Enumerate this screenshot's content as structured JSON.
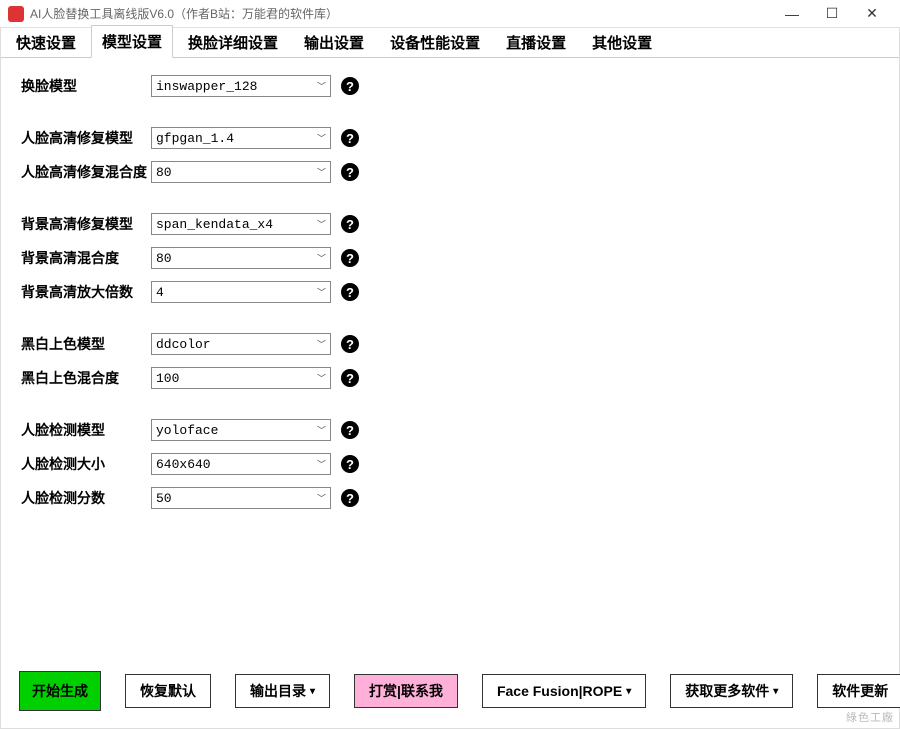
{
  "window": {
    "title": "AI人脸替换工具离线版V6.0（作者B站：万能君的软件库）"
  },
  "tabs": {
    "items": [
      "快速设置",
      "模型设置",
      "换脸详细设置",
      "输出设置",
      "设备性能设置",
      "直播设置",
      "其他设置"
    ],
    "active_index": 1
  },
  "form": {
    "group1": {
      "swap_model": {
        "label": "换脸模型",
        "value": "inswapper_128"
      }
    },
    "group2": {
      "face_enhance_model": {
        "label": "人脸高清修复模型",
        "value": "gfpgan_1.4"
      },
      "face_enhance_blend": {
        "label": "人脸高清修复混合度",
        "value": "80"
      }
    },
    "group3": {
      "bg_enhance_model": {
        "label": "背景高清修复模型",
        "value": "span_kendata_x4"
      },
      "bg_enhance_blend": {
        "label": "背景高清混合度",
        "value": "80"
      },
      "bg_enhance_scale": {
        "label": "背景高清放大倍数",
        "value": "4"
      }
    },
    "group4": {
      "bw_color_model": {
        "label": "黑白上色模型",
        "value": "ddcolor"
      },
      "bw_color_blend": {
        "label": "黑白上色混合度",
        "value": "100"
      }
    },
    "group5": {
      "face_detect_model": {
        "label": "人脸检测模型",
        "value": "yoloface"
      },
      "face_detect_size": {
        "label": "人脸检测大小",
        "value": "640x640"
      },
      "face_detect_score": {
        "label": "人脸检测分数",
        "value": "50"
      }
    }
  },
  "buttons": {
    "start": "开始生成",
    "reset": "恢复默认",
    "output_dir": "输出目录",
    "donate": "打赏|联系我",
    "fusion": "Face Fusion|ROPE",
    "more_software": "获取更多软件",
    "update": "软件更新"
  },
  "watermark": "綠色工廠"
}
